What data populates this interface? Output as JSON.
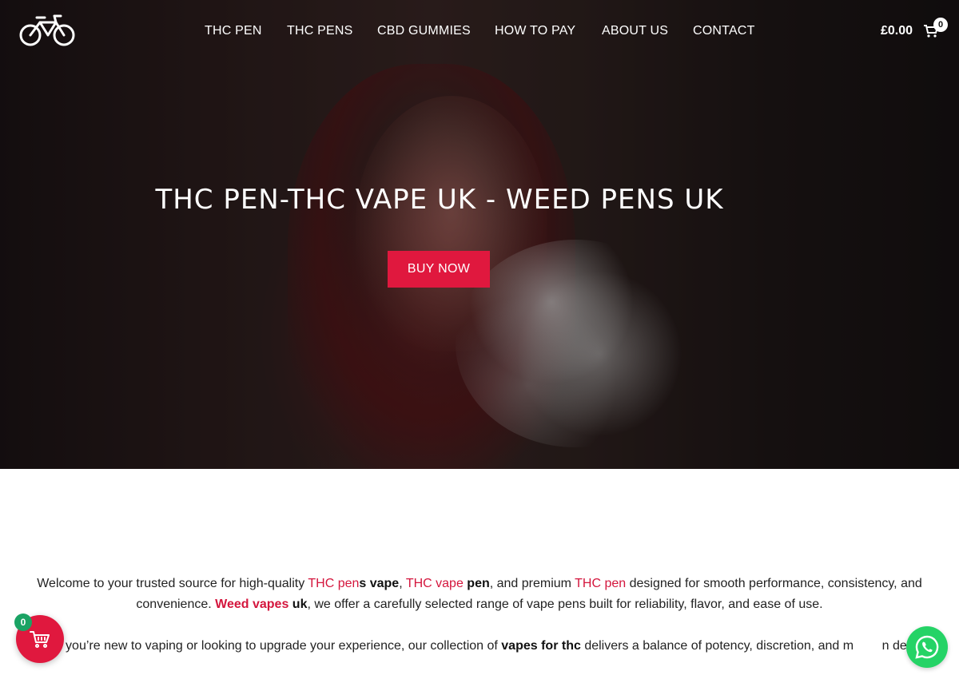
{
  "header": {
    "logo_icon": "bicycle-icon",
    "nav": [
      {
        "label": "THC PEN"
      },
      {
        "label": "THC PENS"
      },
      {
        "label": "CBD GUMMIES"
      },
      {
        "label": "HOW TO PAY"
      },
      {
        "label": "ABOUT US"
      },
      {
        "label": "CONTACT"
      }
    ],
    "cart_total": "£0.00",
    "cart_count": "0",
    "cart_icon": "shopping-cart-icon"
  },
  "hero": {
    "title": "THC PEN-THC VAPE UK - WEED PENS UK",
    "button_label": "BUY NOW",
    "button_color": "#e0183e"
  },
  "content": {
    "p1": {
      "t1": "Welcome to your trusted source for high-quality ",
      "l1": "THC pen",
      "b1": "s vape",
      "t2": ", ",
      "l2": "THC vape",
      "b2": " pen",
      "t3": ", and premium ",
      "l3": "THC pen",
      "t4": " designed for smooth performance, consistency, and convenience. ",
      "l4": "Weed vapes",
      "b3": " uk",
      "t5": ", we offer a carefully selected range of vape pens built for reliability, flavor, and ease of use."
    },
    "p2": {
      "t1": "W        you’re new to vaping or looking to upgrade your experience, our collection of ",
      "b1": "vapes for thc",
      "t2": " delivers a balance of potency, discretion, and m        n design."
    },
    "highlight_color": "#d4163d"
  },
  "floating": {
    "cart_count": "0",
    "cart_icon": "basket-icon",
    "whatsapp_icon": "whatsapp-icon"
  }
}
